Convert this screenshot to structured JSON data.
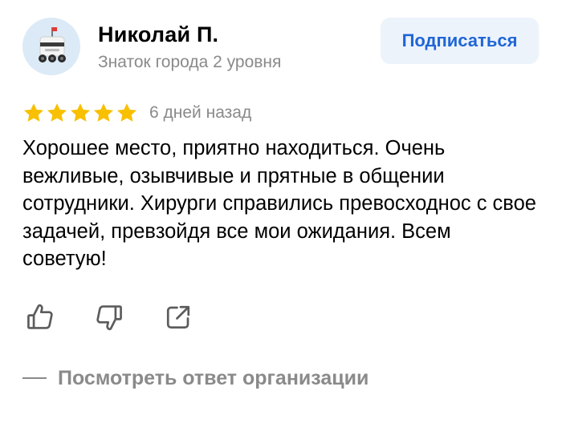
{
  "author": {
    "name": "Николай П.",
    "level": "Знаток города 2 уровня",
    "avatar_icon": "delivery-robot-icon"
  },
  "subscribe": {
    "label": "Подписаться"
  },
  "review": {
    "rating": 5,
    "rating_max": 5,
    "date": "6 дней назад",
    "text": "Хорошее место, приятно находиться. Очень вежливые, озывчивые и прятные в общении сотрудники. Хирурги справились превосходнос с свое задачей, превзойдя все мои ожидания. Всем советую!"
  },
  "actions": {
    "like_icon": "thumbs-up-icon",
    "dislike_icon": "thumbs-down-icon",
    "share_icon": "share-icon"
  },
  "organization_response": {
    "label": "Посмотреть ответ организации"
  },
  "colors": {
    "star": "#f8c000",
    "accent": "#1f66d6",
    "button_bg": "#edf3fb",
    "muted": "#8a8a8a",
    "avatar_bg": "#dbeaf6"
  }
}
